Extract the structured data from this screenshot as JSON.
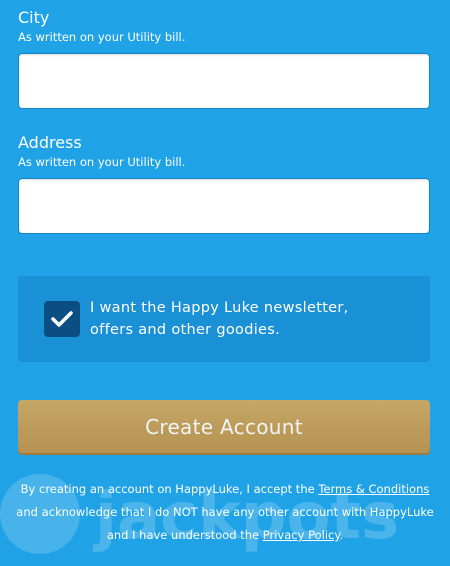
{
  "city": {
    "label": "City",
    "hint": "As written on your Utility bill.",
    "value": ""
  },
  "address": {
    "label": "Address",
    "hint": "As written on your Utility bill.",
    "value": ""
  },
  "newsletter": {
    "checked": true,
    "label": "I want the Happy Luke newsletter, offers and other goodies."
  },
  "create_button": {
    "label": "Create Account"
  },
  "terms": {
    "part1": "By creating an account on HappyLuke, I accept the ",
    "terms_link": "Terms & Conditions",
    "part2": " and acknowledge that I do NOT have any other account with HappyLuke and I have understood the ",
    "privacy_link": "Privacy Policy",
    "part3": "."
  },
  "watermark": {
    "text": "jackpots"
  },
  "colors": {
    "background": "#1fa3e6",
    "panel": "#1a91d6",
    "checkbox": "#0b4f82",
    "button": "#c0a060"
  }
}
